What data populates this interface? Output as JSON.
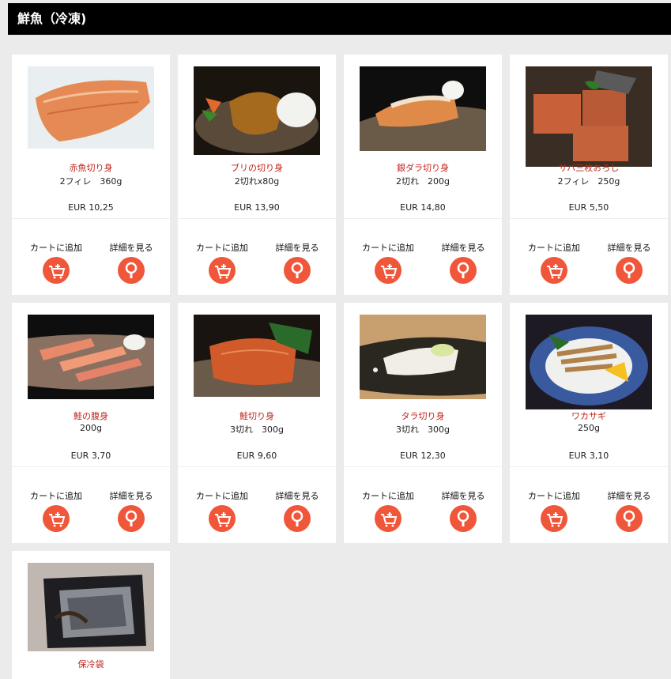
{
  "page": {
    "title": "鮮魚（冷凍)"
  },
  "common": {
    "add_to_cart": "カートに追加",
    "view_details": "詳細を見る",
    "cart_icon": "cart-plus-icon",
    "detail_icon": "magnifier-icon",
    "accent": "#f0563a",
    "name_color": "#c0241c"
  },
  "products": [
    {
      "name": "赤魚切り身",
      "qty": "2フィレ　360g",
      "price": "EUR 10,25"
    },
    {
      "name": "ブリの切り身",
      "qty": "2切れx80g",
      "price": "EUR 13,90"
    },
    {
      "name": "銀ダラ切り身",
      "qty": "2切れ　200g",
      "price": "EUR 14,80"
    },
    {
      "name": "サバ三枚おろし",
      "qty": "2フィレ　250g",
      "price": "EUR 5,50"
    },
    {
      "name": "鮭の腹身",
      "qty": "200g",
      "price": "EUR 3,70"
    },
    {
      "name": "鮭切り身",
      "qty": "3切れ　300g",
      "price": "EUR 9,60"
    },
    {
      "name": "タラ切り身",
      "qty": "3切れ　300g",
      "price": "EUR 12,30"
    },
    {
      "name": "ワカサギ",
      "qty": "250g",
      "price": "EUR 3,10"
    },
    {
      "name": "保冷袋",
      "qty": "",
      "price": ""
    }
  ]
}
